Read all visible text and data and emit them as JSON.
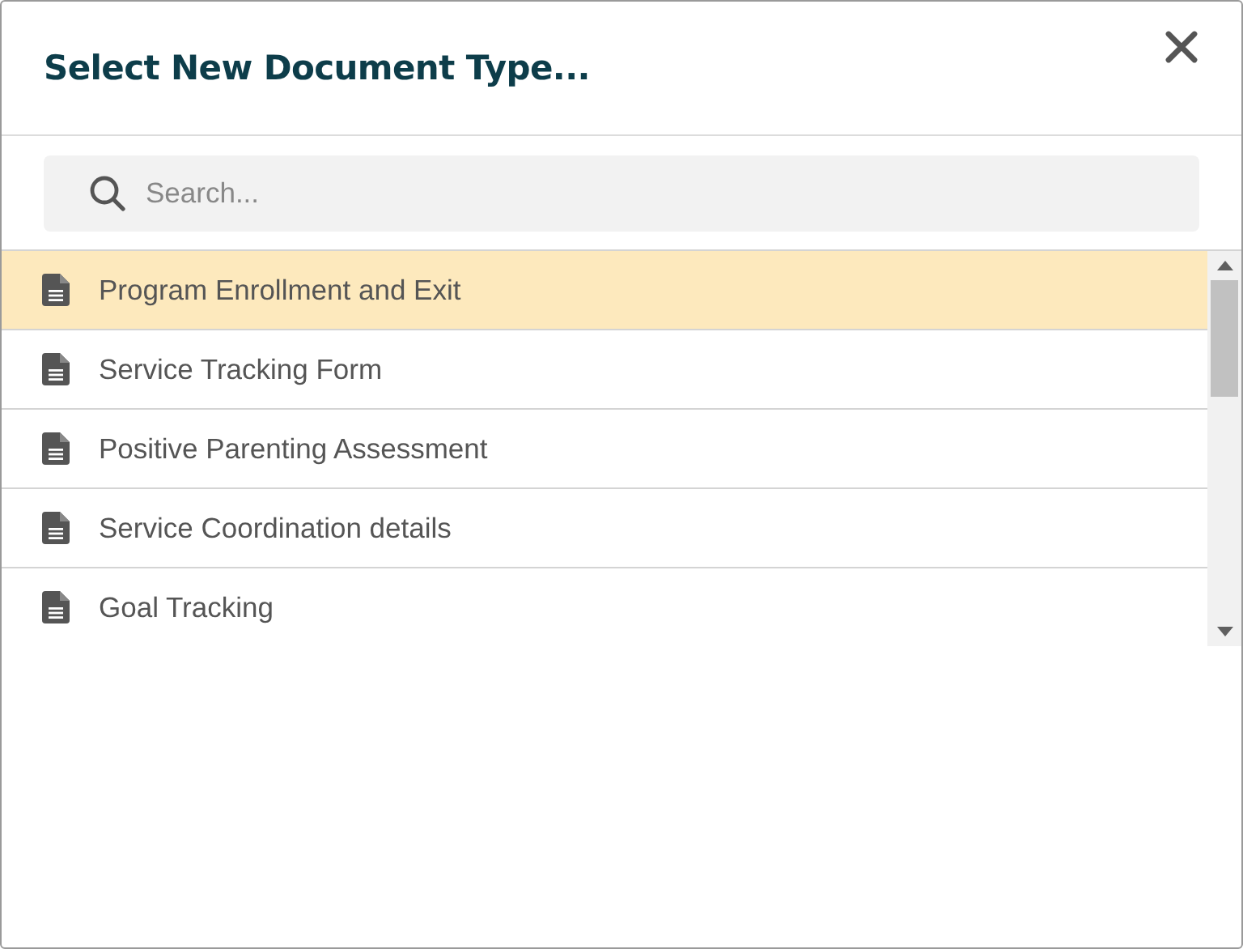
{
  "dialog": {
    "title": "Select New Document Type..."
  },
  "search": {
    "placeholder": "Search..."
  },
  "items": [
    {
      "label": "Program Enrollment and Exit",
      "selected": true
    },
    {
      "label": "Service Tracking Form",
      "selected": false
    },
    {
      "label": "Positive Parenting Assessment",
      "selected": false
    },
    {
      "label": "Service Coordination details",
      "selected": false
    },
    {
      "label": "Goal Tracking",
      "selected": false
    }
  ]
}
